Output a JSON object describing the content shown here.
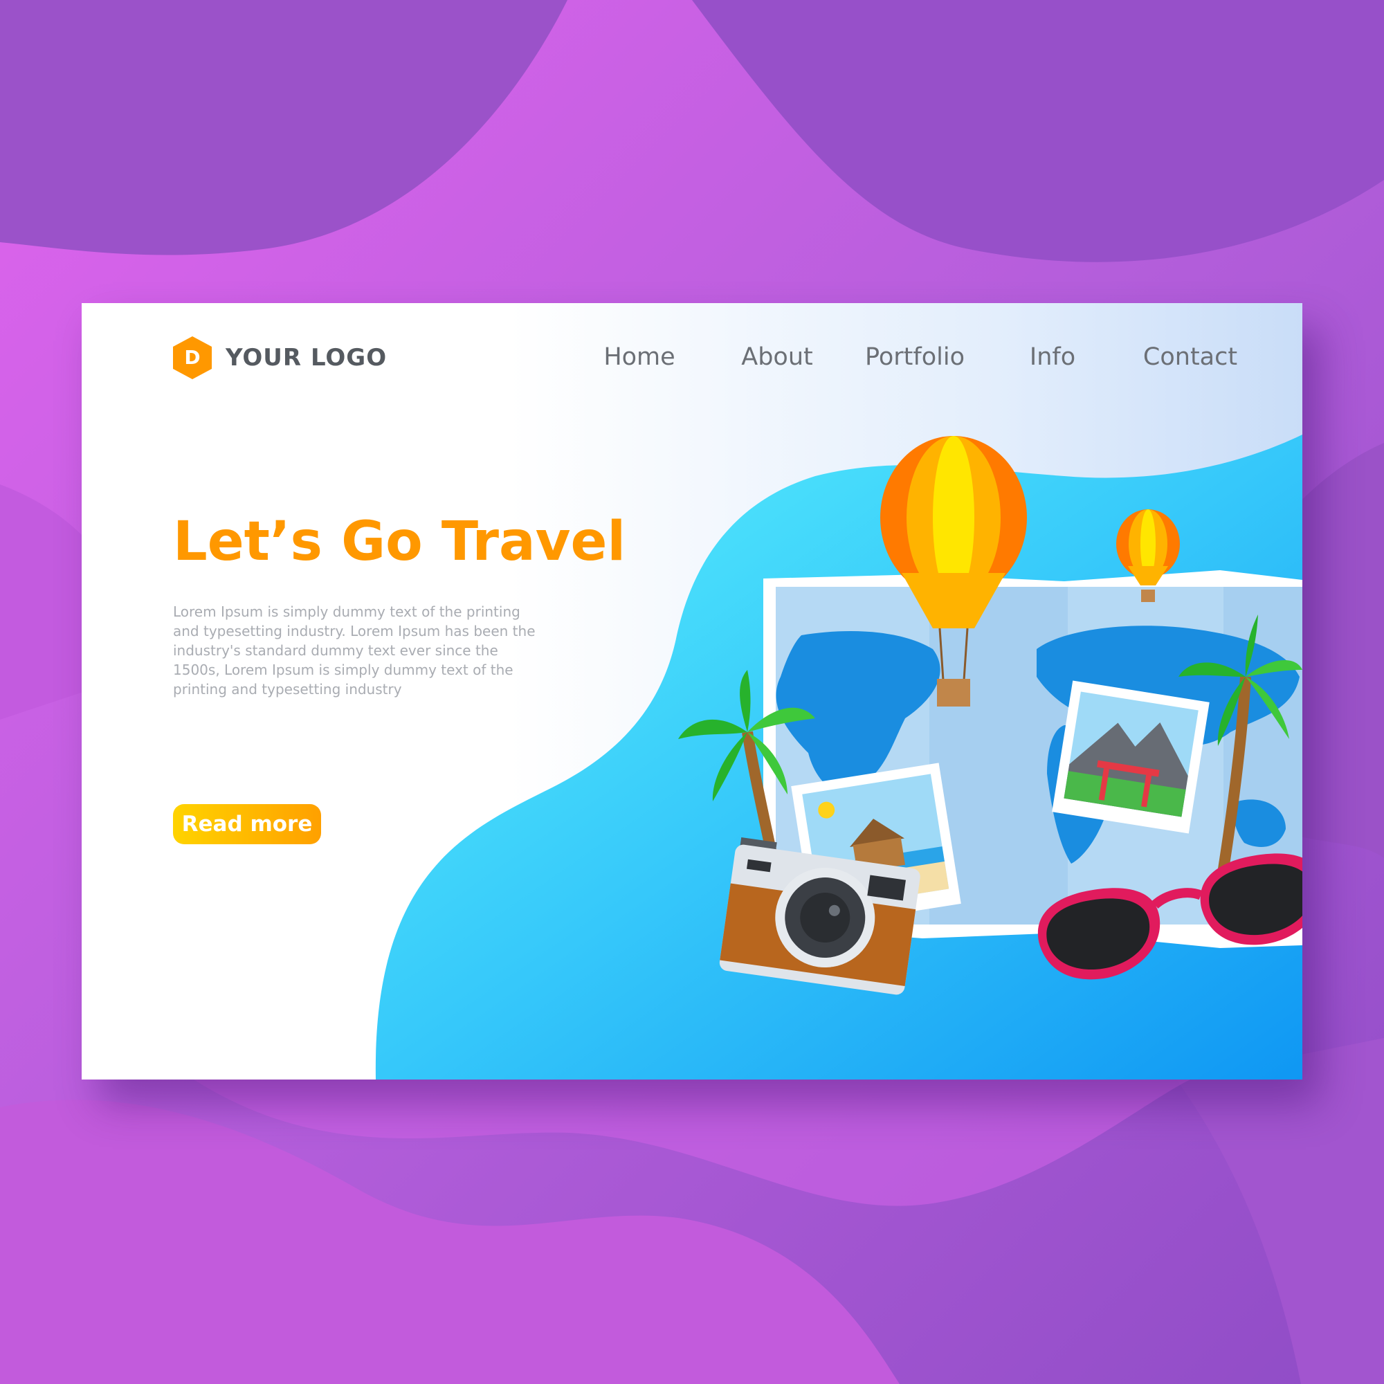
{
  "brand": {
    "logo_letter": "D",
    "logo_text": "YOUR LOGO"
  },
  "nav": {
    "items": [
      {
        "label": "Home"
      },
      {
        "label": "About"
      },
      {
        "label": "Portfolio"
      },
      {
        "label": "Info"
      },
      {
        "label": "Contact"
      }
    ]
  },
  "hero": {
    "title": "Let’s Go Travel",
    "text": "Lorem Ipsum is simply dummy text of the printing and typesetting industry. Lorem Ipsum has been the industry's standard dummy text ever since the 1500s, Lorem Ipsum is simply dummy text of the printing and typesetting industry",
    "button_label": "Read more"
  },
  "colors": {
    "background": "#a055d8",
    "accent": "#ff9800",
    "button_start": "#ffd300",
    "button_end": "#ffa000",
    "wave_light": "#55f0fb",
    "wave_dark": "#119bf4"
  },
  "illustration": {
    "icons": [
      "world-map-icon",
      "hot-air-balloon-icon",
      "palm-tree-icon",
      "photo-icon",
      "camera-icon",
      "sunglasses-icon"
    ]
  }
}
